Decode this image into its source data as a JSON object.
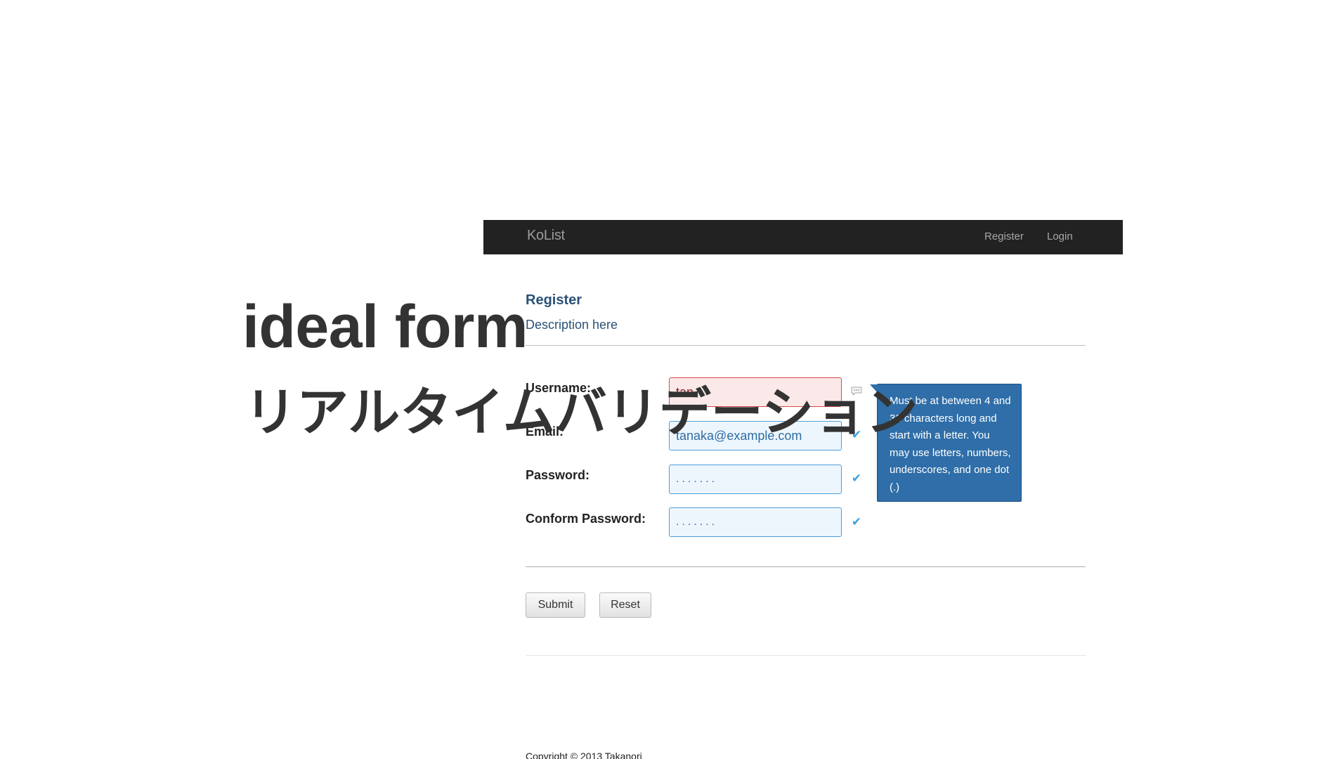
{
  "navbar": {
    "brand": "KoList",
    "links": [
      {
        "label": "Register"
      },
      {
        "label": "Login"
      }
    ]
  },
  "form": {
    "title": "Register",
    "description": "Description here",
    "fields": [
      {
        "label": "Username:",
        "value": "tan",
        "state": "invalid",
        "status_icon": "speech-bubble-icon"
      },
      {
        "label": "Email:",
        "value": "tanaka@example.com",
        "state": "valid",
        "status_icon": "check-icon"
      },
      {
        "label": "Password:",
        "value": ".......",
        "state": "valid",
        "status_icon": "check-icon"
      },
      {
        "label": "Conform Password:",
        "value": ".......",
        "state": "valid",
        "status_icon": "check-icon"
      }
    ],
    "tooltip": "Must be at between 4 and 32 characters long and start with a letter. You may use letters, numbers, underscores, and one dot (.)",
    "buttons": {
      "submit": "Submit",
      "reset": "Reset"
    }
  },
  "footer": {
    "copyright": "Copyright © 2013 Takanori"
  },
  "overlay": {
    "title": "ideal form",
    "subtitle": "リアルタイムバリデーション"
  },
  "colors": {
    "navbar_bg": "#222222",
    "invalid_border": "#d94848",
    "valid_border": "#4a9ed8",
    "tooltip_bg": "#2f6ea8",
    "check": "#39a0e0"
  }
}
